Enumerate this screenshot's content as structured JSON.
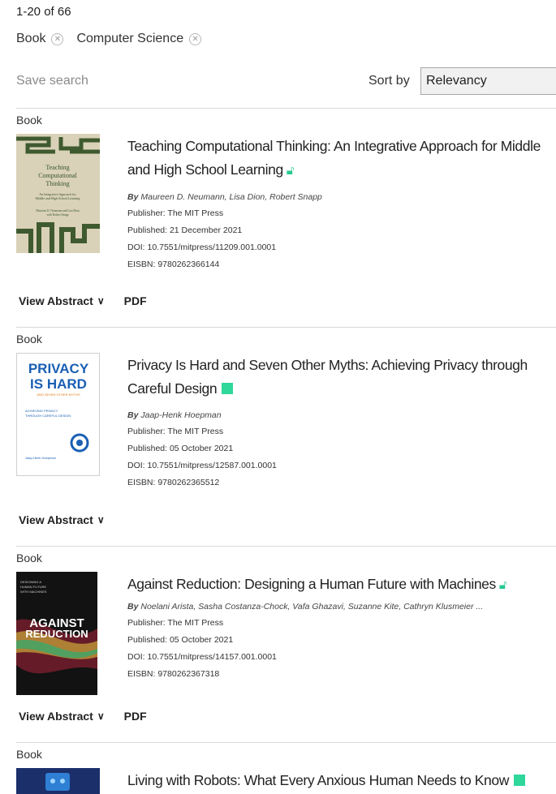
{
  "results_count": "1-20 of 66",
  "filters": [
    {
      "label": "Book"
    },
    {
      "label": "Computer Science"
    }
  ],
  "toolbar": {
    "save_search": "Save search",
    "sort_label": "Sort by",
    "sort_value": "Relevancy"
  },
  "icons": {
    "remove": "close-icon",
    "open_access": "open-access-icon",
    "free": "free-access-square-icon",
    "chevron": "chevron-down-icon"
  },
  "colors": {
    "open_access": "#26c98f",
    "free_access": "#2ed79a"
  },
  "results": [
    {
      "type": "Book",
      "title_line1": "Teaching Computational Thinking: An Integrative Approach for Middle",
      "title_line2": "and High School Learning",
      "access": "open",
      "by": "By",
      "authors": "Maureen D. Neumann, Lisa Dion, Robert Snapp",
      "publisher": "Publisher: The MIT Press",
      "published": "Published: 21 December 2021",
      "doi": "DOI: 10.7551/mitpress/11209.001.0001",
      "eisbn": "EISBN: 9780262366144",
      "view_abstract": "View Abstract",
      "pdf": "PDF",
      "cover": {
        "title": "Teaching Computational Thinking",
        "subtitle": "An Integrative Approach for Middle and High School Learning",
        "authors": "Maureen D. Neumann and Lisa Dion with Robert Snapp"
      }
    },
    {
      "type": "Book",
      "title_line1": "Privacy Is Hard and Seven Other Myths: Achieving Privacy through",
      "title_line2": "Careful Design",
      "access": "free",
      "by": "By",
      "authors": "Jaap-Henk Hoepman",
      "publisher": "Publisher: The MIT Press",
      "published": "Published: 05 October 2021",
      "doi": "DOI: 10.7551/mitpress/12587.001.0001",
      "eisbn": "EISBN: 9780262365512",
      "view_abstract": "View Abstract",
      "cover": {
        "line1": "PRIVACY",
        "line2": "IS HARD",
        "sub": "AND SEVEN OTHER MYTHS",
        "sub2": "ACHIEVING PRIVACY THROUGH CAREFUL DESIGN",
        "author": "Jaap-Henk Hoepman"
      }
    },
    {
      "type": "Book",
      "title_line1": "Against Reduction: Designing a Human Future with Machines",
      "access": "open",
      "by": "By",
      "authors": "Noelani Arista, Sasha Costanza-Chock, Vafa Ghazavi, Suzanne Kite, Cathryn Klusmeier ...",
      "publisher": "Publisher: The MIT Press",
      "published": "Published: 05 October 2021",
      "doi": "DOI: 10.7551/mitpress/14157.001.0001",
      "eisbn": "EISBN: 9780262367318",
      "view_abstract": "View Abstract",
      "pdf": "PDF",
      "cover": {
        "top": "DESIGNING A HUMAN FUTURE WITH MACHINES",
        "line1": "AGAINST",
        "line2": "REDUCTION"
      }
    },
    {
      "type": "Book",
      "title_line1": "Living with Robots: What Every Anxious Human Needs to Know",
      "access": "free"
    }
  ]
}
